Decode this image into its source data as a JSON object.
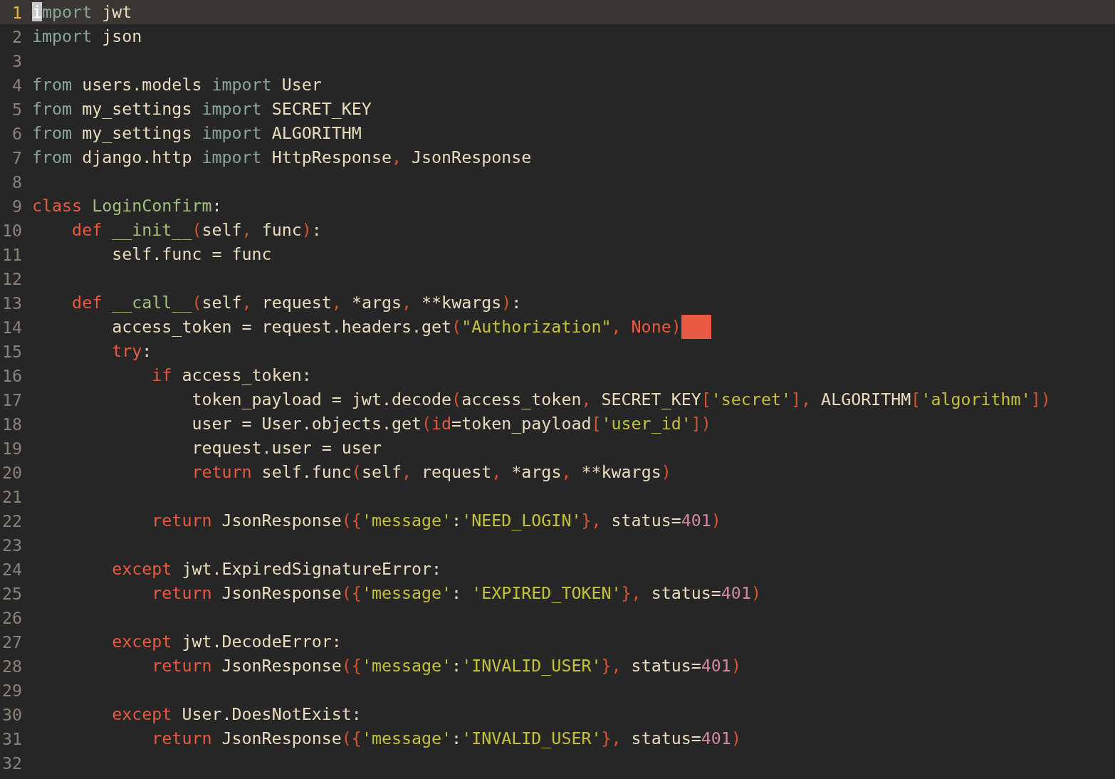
{
  "editor": {
    "lines": [
      {
        "number": "1",
        "current": true,
        "tokens": [
          {
            "kind": "cursor",
            "text": "i"
          },
          {
            "kind": "import",
            "text": "mport"
          },
          {
            "kind": "plain",
            "text": " jwt"
          }
        ]
      },
      {
        "number": "2",
        "current": false,
        "tokens": [
          {
            "kind": "import",
            "text": "import"
          },
          {
            "kind": "plain",
            "text": " json"
          }
        ]
      },
      {
        "number": "3",
        "current": false
      },
      {
        "number": "4",
        "current": false,
        "tokens": [
          {
            "kind": "import",
            "text": "from"
          },
          {
            "kind": "plain",
            "text": " users.models "
          },
          {
            "kind": "import",
            "text": "import"
          },
          {
            "kind": "plain",
            "text": " User"
          }
        ]
      },
      {
        "number": "5",
        "current": false,
        "tokens": [
          {
            "kind": "import",
            "text": "from"
          },
          {
            "kind": "plain",
            "text": " my_settings "
          },
          {
            "kind": "import",
            "text": "import"
          },
          {
            "kind": "plain",
            "text": " SECRET_KEY"
          }
        ]
      },
      {
        "number": "6",
        "current": false,
        "tokens": [
          {
            "kind": "import",
            "text": "from"
          },
          {
            "kind": "plain",
            "text": " my_settings "
          },
          {
            "kind": "import",
            "text": "import"
          },
          {
            "kind": "plain",
            "text": " ALGORITHM"
          }
        ]
      },
      {
        "number": "7",
        "current": false,
        "tokens": [
          {
            "kind": "import",
            "text": "from"
          },
          {
            "kind": "plain",
            "text": " django.http "
          },
          {
            "kind": "import",
            "text": "import"
          },
          {
            "kind": "plain",
            "text": " HttpResponse"
          },
          {
            "kind": "punct",
            "text": ","
          },
          {
            "kind": "plain",
            "text": " JsonResponse"
          }
        ]
      },
      {
        "number": "8",
        "current": false
      },
      {
        "number": "9",
        "current": false,
        "tokens": [
          {
            "kind": "keyword",
            "text": "class "
          },
          {
            "kind": "name",
            "text": "LoginConfirm"
          },
          {
            "kind": "plain",
            "text": ":"
          }
        ]
      },
      {
        "number": "10",
        "current": false,
        "tokens": [
          {
            "kind": "keyword",
            "text": "    def "
          },
          {
            "kind": "name",
            "text": "__init__"
          },
          {
            "kind": "punct",
            "text": "("
          },
          {
            "kind": "plain",
            "text": "self"
          },
          {
            "kind": "punct",
            "text": ","
          },
          {
            "kind": "plain",
            "text": " func"
          },
          {
            "kind": "punct",
            "text": ")"
          },
          {
            "kind": "plain",
            "text": ":"
          }
        ]
      },
      {
        "number": "11",
        "current": false,
        "tokens": [
          {
            "kind": "plain",
            "text": "        self.func = func"
          }
        ]
      },
      {
        "number": "12",
        "current": false
      },
      {
        "number": "13",
        "current": false,
        "tokens": [
          {
            "kind": "keyword",
            "text": "    def "
          },
          {
            "kind": "name",
            "text": "__call__"
          },
          {
            "kind": "punct",
            "text": "("
          },
          {
            "kind": "plain",
            "text": "self"
          },
          {
            "kind": "punct",
            "text": ","
          },
          {
            "kind": "plain",
            "text": " request"
          },
          {
            "kind": "punct",
            "text": ","
          },
          {
            "kind": "plain",
            "text": " *args"
          },
          {
            "kind": "punct",
            "text": ","
          },
          {
            "kind": "plain",
            "text": " **kwargs"
          },
          {
            "kind": "punct",
            "text": ")"
          },
          {
            "kind": "plain",
            "text": ":"
          }
        ]
      },
      {
        "number": "14",
        "current": false,
        "marker": true,
        "tokens": [
          {
            "kind": "plain",
            "text": "        access_token = request.headers.get"
          },
          {
            "kind": "punct",
            "text": "("
          },
          {
            "kind": "string",
            "text": "\"Authorization\""
          },
          {
            "kind": "punct",
            "text": ", "
          },
          {
            "kind": "keyword",
            "text": "None"
          },
          {
            "kind": "punct",
            "text": ")"
          }
        ]
      },
      {
        "number": "15",
        "current": false,
        "tokens": [
          {
            "kind": "keyword",
            "text": "        try"
          },
          {
            "kind": "plain",
            "text": ":"
          }
        ]
      },
      {
        "number": "16",
        "current": false,
        "tokens": [
          {
            "kind": "keyword",
            "text": "            if"
          },
          {
            "kind": "plain",
            "text": " access_token:"
          }
        ]
      },
      {
        "number": "17",
        "current": false,
        "tokens": [
          {
            "kind": "plain",
            "text": "                token_payload = jwt.decode"
          },
          {
            "kind": "punct",
            "text": "("
          },
          {
            "kind": "plain",
            "text": "access_token"
          },
          {
            "kind": "punct",
            "text": ","
          },
          {
            "kind": "plain",
            "text": " SECRET_KEY"
          },
          {
            "kind": "punct",
            "text": "["
          },
          {
            "kind": "string",
            "text": "'secret'"
          },
          {
            "kind": "punct",
            "text": "],"
          },
          {
            "kind": "plain",
            "text": " ALGORITHM"
          },
          {
            "kind": "punct",
            "text": "["
          },
          {
            "kind": "string",
            "text": "'algorithm'"
          },
          {
            "kind": "punct",
            "text": "])"
          }
        ]
      },
      {
        "number": "18",
        "current": false,
        "tokens": [
          {
            "kind": "plain",
            "text": "                user = User.objects.get"
          },
          {
            "kind": "punct",
            "text": "("
          },
          {
            "kind": "keyword",
            "text": "id"
          },
          {
            "kind": "plain",
            "text": "=token_payload"
          },
          {
            "kind": "punct",
            "text": "["
          },
          {
            "kind": "string",
            "text": "'user_id'"
          },
          {
            "kind": "punct",
            "text": "])"
          }
        ]
      },
      {
        "number": "19",
        "current": false,
        "tokens": [
          {
            "kind": "plain",
            "text": "                request.user = user"
          }
        ]
      },
      {
        "number": "20",
        "current": false,
        "tokens": [
          {
            "kind": "keyword",
            "text": "                return"
          },
          {
            "kind": "plain",
            "text": " self.func"
          },
          {
            "kind": "punct",
            "text": "("
          },
          {
            "kind": "plain",
            "text": "self"
          },
          {
            "kind": "punct",
            "text": ","
          },
          {
            "kind": "plain",
            "text": " request"
          },
          {
            "kind": "punct",
            "text": ","
          },
          {
            "kind": "plain",
            "text": " *args"
          },
          {
            "kind": "punct",
            "text": ","
          },
          {
            "kind": "plain",
            "text": " **kwargs"
          },
          {
            "kind": "punct",
            "text": ")"
          }
        ]
      },
      {
        "number": "21",
        "current": false
      },
      {
        "number": "22",
        "current": false,
        "tokens": [
          {
            "kind": "keyword",
            "text": "            return"
          },
          {
            "kind": "plain",
            "text": " JsonResponse"
          },
          {
            "kind": "punct",
            "text": "({"
          },
          {
            "kind": "string",
            "text": "'message'"
          },
          {
            "kind": "plain",
            "text": ":"
          },
          {
            "kind": "string",
            "text": "'NEED_LOGIN'"
          },
          {
            "kind": "punct",
            "text": "},"
          },
          {
            "kind": "plain",
            "text": " status="
          },
          {
            "kind": "number",
            "text": "401"
          },
          {
            "kind": "punct",
            "text": ")"
          }
        ]
      },
      {
        "number": "23",
        "current": false
      },
      {
        "number": "24",
        "current": false,
        "tokens": [
          {
            "kind": "keyword",
            "text": "        except"
          },
          {
            "kind": "plain",
            "text": " jwt.ExpiredSignatureError:"
          }
        ]
      },
      {
        "number": "25",
        "current": false,
        "tokens": [
          {
            "kind": "keyword",
            "text": "            return"
          },
          {
            "kind": "plain",
            "text": " JsonResponse"
          },
          {
            "kind": "punct",
            "text": "({"
          },
          {
            "kind": "string",
            "text": "'message'"
          },
          {
            "kind": "plain",
            "text": ": "
          },
          {
            "kind": "string",
            "text": "'EXPIRED_TOKEN'"
          },
          {
            "kind": "punct",
            "text": "},"
          },
          {
            "kind": "plain",
            "text": " status="
          },
          {
            "kind": "number",
            "text": "401"
          },
          {
            "kind": "punct",
            "text": ")"
          }
        ]
      },
      {
        "number": "26",
        "current": false
      },
      {
        "number": "27",
        "current": false,
        "tokens": [
          {
            "kind": "keyword",
            "text": "        except"
          },
          {
            "kind": "plain",
            "text": " jwt.DecodeError:"
          }
        ]
      },
      {
        "number": "28",
        "current": false,
        "tokens": [
          {
            "kind": "keyword",
            "text": "            return"
          },
          {
            "kind": "plain",
            "text": " JsonResponse"
          },
          {
            "kind": "punct",
            "text": "({"
          },
          {
            "kind": "string",
            "text": "'message'"
          },
          {
            "kind": "plain",
            "text": ":"
          },
          {
            "kind": "string",
            "text": "'INVALID_USER'"
          },
          {
            "kind": "punct",
            "text": "},"
          },
          {
            "kind": "plain",
            "text": " status="
          },
          {
            "kind": "number",
            "text": "401"
          },
          {
            "kind": "punct",
            "text": ")"
          }
        ]
      },
      {
        "number": "29",
        "current": false
      },
      {
        "number": "30",
        "current": false,
        "tokens": [
          {
            "kind": "keyword",
            "text": "        except"
          },
          {
            "kind": "plain",
            "text": " User.DoesNotExist:"
          }
        ]
      },
      {
        "number": "31",
        "current": false,
        "tokens": [
          {
            "kind": "keyword",
            "text": "            return"
          },
          {
            "kind": "plain",
            "text": " JsonResponse"
          },
          {
            "kind": "punct",
            "text": "({"
          },
          {
            "kind": "string",
            "text": "'message'"
          },
          {
            "kind": "plain",
            "text": ":"
          },
          {
            "kind": "string",
            "text": "'INVALID_USER'"
          },
          {
            "kind": "punct",
            "text": "},"
          },
          {
            "kind": "plain",
            "text": " status="
          },
          {
            "kind": "number",
            "text": "401"
          },
          {
            "kind": "punct",
            "text": ")"
          }
        ]
      },
      {
        "number": "32",
        "current": false
      }
    ]
  }
}
